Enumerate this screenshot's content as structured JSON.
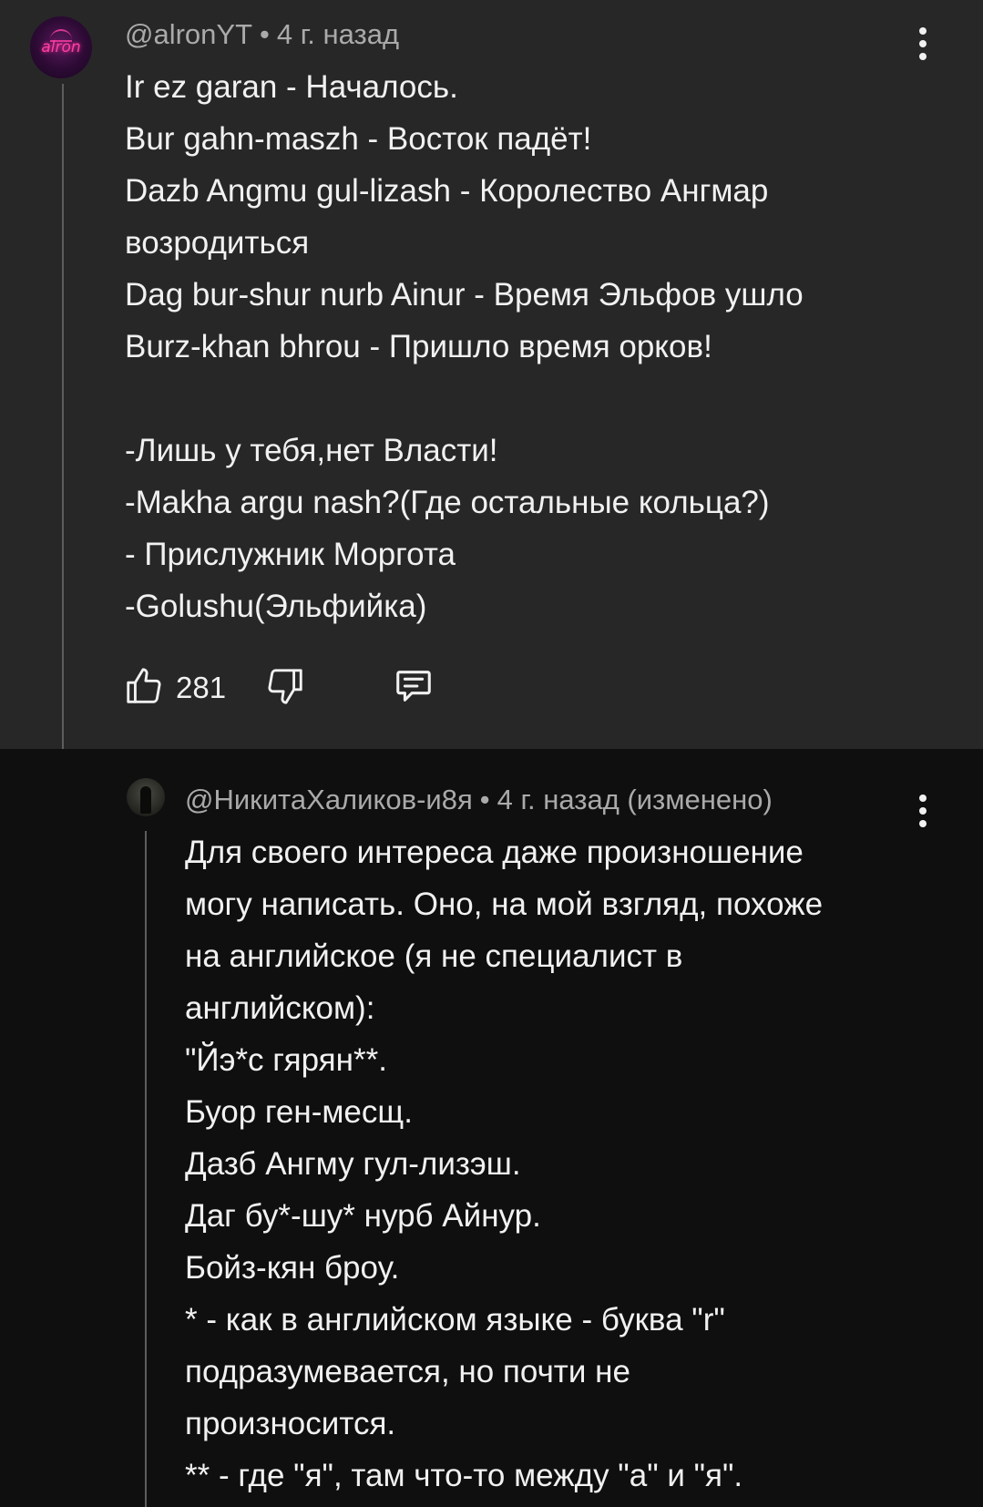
{
  "comments": [
    {
      "author": "@alronYT",
      "time": "4 г. назад",
      "avatar_text": "alron",
      "text": "Ir ez garan - Началось.\nBur gahn-maszh - Восток падёт!\nDazb Angmu gul-lizash - Королество Ангмар\nвозродиться\nDag bur-shur nurb Ainur - Время Эльфов ушло\nBurz-khan bhrou - Пришло время орков!\n\n-Лишь у тебя,нет Власти!\n-Makha argu nash?(Где остальные кольца?)\n- Прислужник Моргота\n-Golushu(Эльфийка)",
      "likes": "281",
      "icons": [
        "thumbs-up-icon",
        "thumbs-down-icon",
        "reply-icon",
        "more-vert-icon"
      ]
    },
    {
      "author": "@НикитаХаликов-и8я",
      "time": "4 г. назад (изменено)",
      "text": "Для своего интереса даже произношение\nмогу написать. Оно, на мой взгляд, похоже\nна английское (я не специалист в\nанглийском):\n\"Йэ*с гярян**.\nБуор ген-месщ.\nДазб Ангму гул-лизэш.\nДаг бу*-шу* нурб Айнур.\nБойз-кян броу.\n* - как в английском  языке - буква \"r\"\nподразумевается, но почти не\nпроизносится.\n** - где \"я\", там что-то между \"а\" и \"я\".",
      "icons": [
        "more-vert-icon"
      ]
    }
  ],
  "colors": {
    "background": "#0f0f0f",
    "highlighted_comment": "#272727",
    "text_primary": "#f1f1f1",
    "text_secondary": "#aaaaaa",
    "thread_line": "#5d5d5d",
    "avatar_accent": "#ff3fa4"
  }
}
